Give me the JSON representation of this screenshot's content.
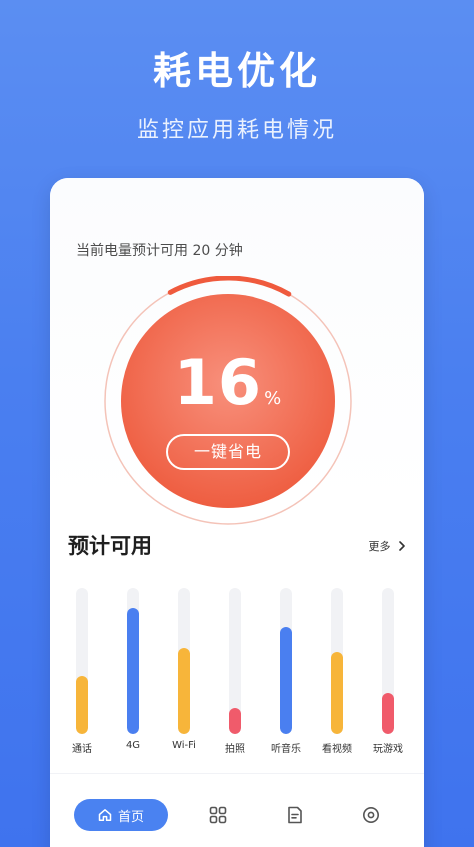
{
  "hero": {
    "title": "耗电优化",
    "subtitle": "监控应用耗电情况"
  },
  "status": {
    "estimate_text": "当前电量预计可用 20 分钟",
    "battery_percent": 16,
    "battery_number": "16",
    "battery_unit": "%",
    "one_key_save_label": "一键省电"
  },
  "usage": {
    "section_title": "预计可用",
    "more_label": "更多",
    "items": [
      {
        "label": "通话",
        "level": 0.4,
        "color": "#f7b53a"
      },
      {
        "label": "4G",
        "level": 0.86,
        "color": "#4a7ff0"
      },
      {
        "label": "Wi-Fi",
        "level": 0.59,
        "color": "#f7b53a"
      },
      {
        "label": "拍照",
        "level": 0.18,
        "color": "#f05b6b"
      },
      {
        "label": "听音乐",
        "level": 0.73,
        "color": "#4a7ff0"
      },
      {
        "label": "看视频",
        "level": 0.56,
        "color": "#f7b53a"
      },
      {
        "label": "玩游戏",
        "level": 0.28,
        "color": "#f05b6b"
      }
    ]
  },
  "nav": {
    "home_label": "首页"
  },
  "colors": {
    "primary": "#4a82f1",
    "battery_orange": "#f26b4c",
    "ring_accent": "#ef5a3d"
  }
}
